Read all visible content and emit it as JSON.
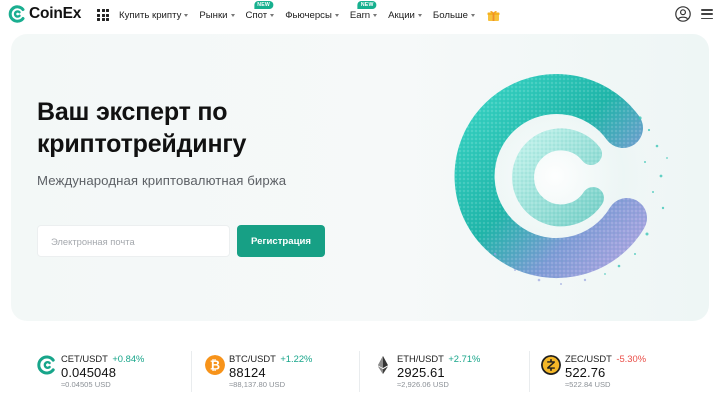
{
  "header": {
    "logo_text": "CoinEx",
    "nav": [
      {
        "label": "Купить крипту",
        "caret": true,
        "badge": ""
      },
      {
        "label": "Рынки",
        "caret": true,
        "badge": ""
      },
      {
        "label": "Спот",
        "caret": true,
        "badge": "NEW"
      },
      {
        "label": "Фьючерсы",
        "caret": true,
        "badge": ""
      },
      {
        "label": "Earn",
        "caret": true,
        "badge": "NEW"
      },
      {
        "label": "Акции",
        "caret": true,
        "badge": ""
      },
      {
        "label": "Больше",
        "caret": true,
        "badge": ""
      }
    ],
    "icons": [
      "apps-grid-icon",
      "gift-icon",
      "user-icon",
      "menu-icon"
    ]
  },
  "hero": {
    "title": "Ваш эксперт по\nкриптотрейдингу",
    "subtitle": "Международная криптовалютная биржа",
    "email_placeholder": "Электронная почта",
    "email_value": "",
    "signup_label": "Регистрация"
  },
  "colors": {
    "brand": "#17a085",
    "positive": "#17a58a",
    "negative": "#ea4d47"
  },
  "ticker": [
    {
      "pair": "CET/USDT",
      "change": "+0.84%",
      "direction": "up",
      "price": "0.045048",
      "usd": "≈0.04505 USD",
      "icon": "cet-coin-icon"
    },
    {
      "pair": "BTC/USDT",
      "change": "+1.22%",
      "direction": "up",
      "price": "88124",
      "usd": "≈88,137.80 USD",
      "icon": "btc-coin-icon"
    },
    {
      "pair": "ETH/USDT",
      "change": "+2.71%",
      "direction": "up",
      "price": "2925.61",
      "usd": "≈2,926.06 USD",
      "icon": "eth-coin-icon"
    },
    {
      "pair": "ZEC/USDT",
      "change": "-5.30%",
      "direction": "down",
      "price": "522.76",
      "usd": "≈522.84 USD",
      "icon": "zec-coin-icon"
    }
  ]
}
